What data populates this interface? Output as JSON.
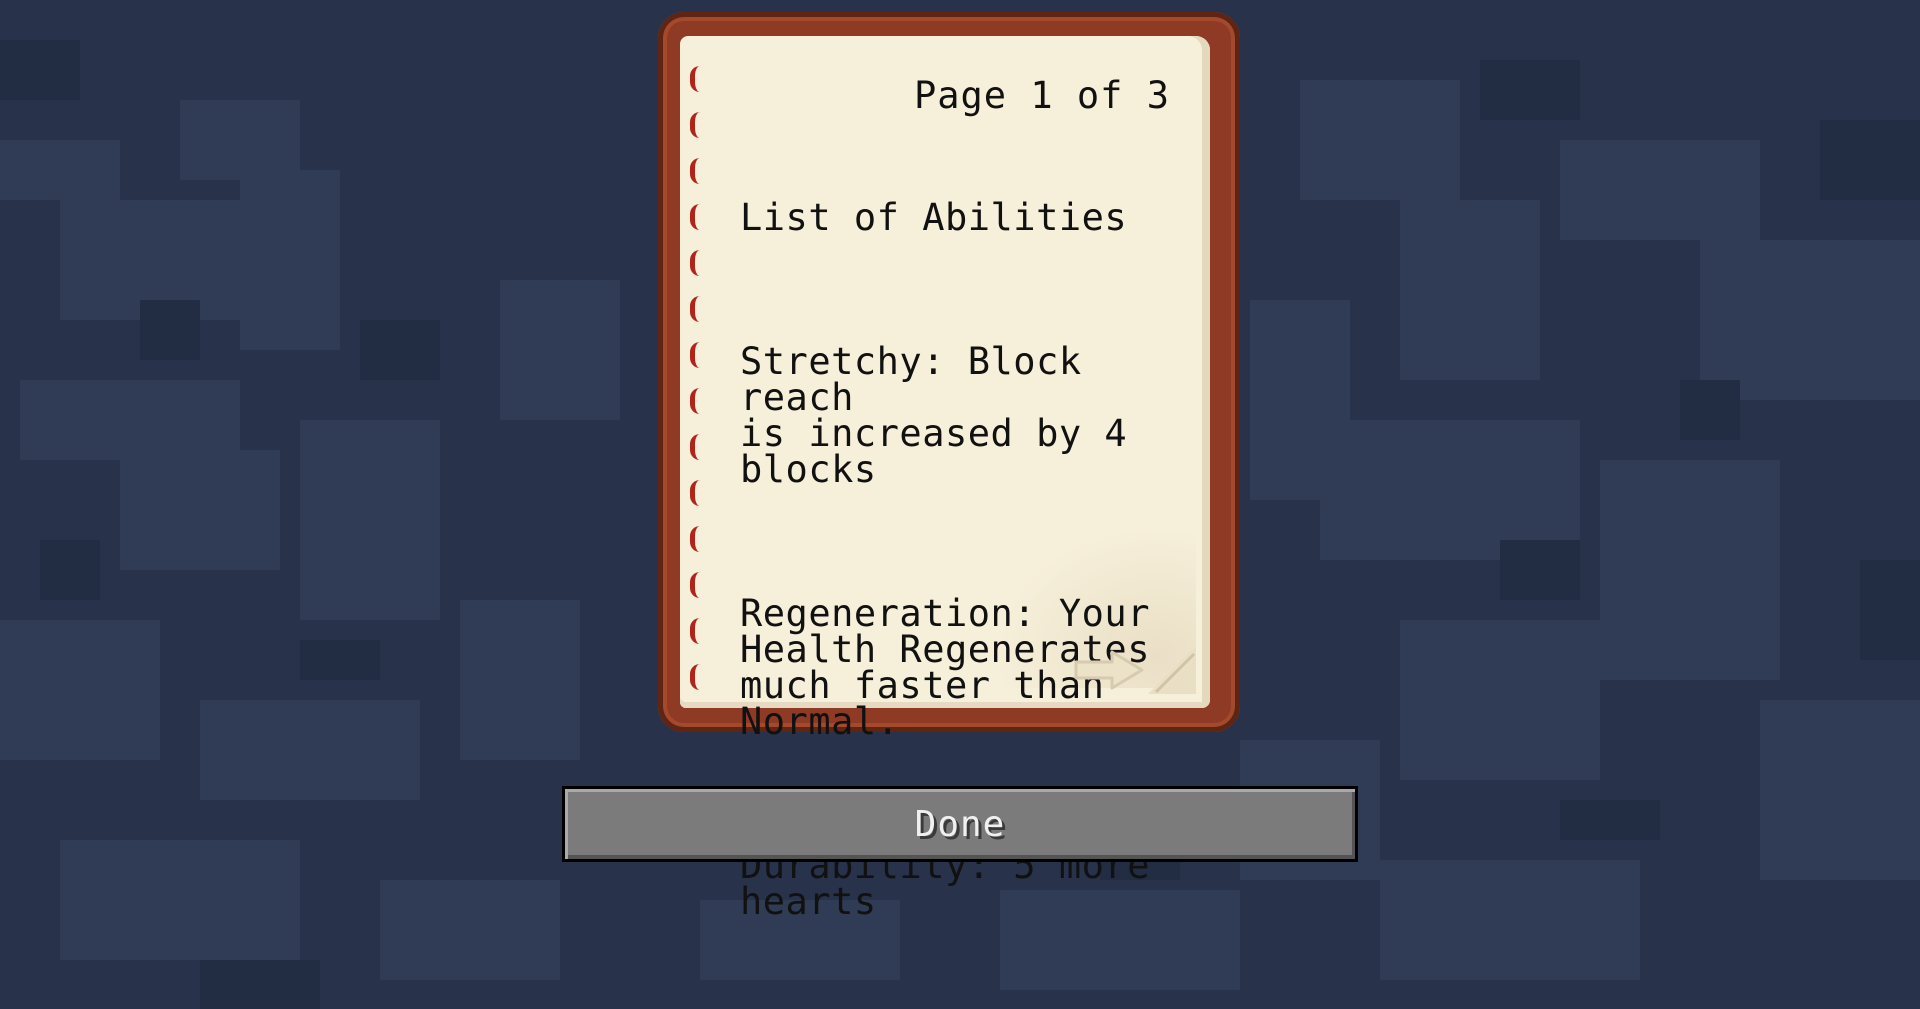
{
  "book": {
    "page_indicator": "Page 1 of 3",
    "title": "List of Abilities",
    "paragraphs": [
      "Stretchy: Block reach\nis increased by 4\nblocks",
      "Regeneration: Your\nHealth Regenerates\nmuch faster than\nNormal.",
      "Durability: 5 more\nhearts"
    ],
    "next_page_icon": "arrow-right-icon"
  },
  "done_button": {
    "label": "Done"
  },
  "colors": {
    "background": "#28334b",
    "book_cover": "#8f3a25",
    "page": "#f6efd9",
    "binding": "#b0241c",
    "button": "#7b7b7b"
  }
}
